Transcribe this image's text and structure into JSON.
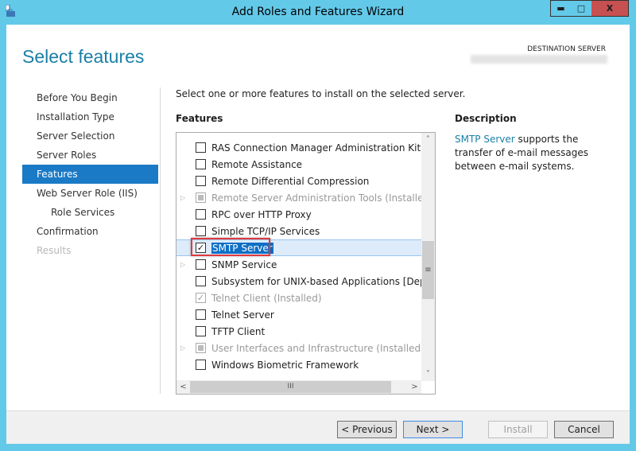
{
  "window": {
    "title": "Add Roles and Features Wizard",
    "minimize": "▬",
    "maximize": "□",
    "close": "X",
    "accent": "#63c9e9",
    "close_color": "#c75050"
  },
  "header": {
    "page_title": "Select features",
    "destination_label": "DESTINATION SERVER"
  },
  "nav": {
    "items": [
      {
        "label": "Before You Begin",
        "state": "normal"
      },
      {
        "label": "Installation Type",
        "state": "normal"
      },
      {
        "label": "Server Selection",
        "state": "normal"
      },
      {
        "label": "Server Roles",
        "state": "normal"
      },
      {
        "label": "Features",
        "state": "active"
      },
      {
        "label": "Web Server Role (IIS)",
        "state": "normal"
      },
      {
        "label": "Role Services",
        "state": "sub"
      },
      {
        "label": "Confirmation",
        "state": "normal"
      },
      {
        "label": "Results",
        "state": "disabled"
      }
    ]
  },
  "main": {
    "instruction": "Select one or more features to install on the selected server.",
    "features_heading": "Features",
    "features": [
      {
        "label": "RAS Connection Manager Administration Kit (CMA",
        "checked": false,
        "expandable": false,
        "installed": false
      },
      {
        "label": "Remote Assistance",
        "checked": false,
        "expandable": false,
        "installed": false
      },
      {
        "label": "Remote Differential Compression",
        "checked": false,
        "expandable": false,
        "installed": false
      },
      {
        "label": "Remote Server Administration Tools (Installed)",
        "checked": "partial",
        "expandable": true,
        "installed": true
      },
      {
        "label": "RPC over HTTP Proxy",
        "checked": false,
        "expandable": false,
        "installed": false
      },
      {
        "label": "Simple TCP/IP Services",
        "checked": false,
        "expandable": false,
        "installed": false
      },
      {
        "label": "SMTP Server",
        "checked": true,
        "expandable": false,
        "installed": false,
        "selected": true
      },
      {
        "label": "SNMP Service",
        "checked": false,
        "expandable": true,
        "installed": false
      },
      {
        "label": "Subsystem for UNIX-based Applications [Deprecat",
        "checked": false,
        "expandable": false,
        "installed": false
      },
      {
        "label": "Telnet Client (Installed)",
        "checked": true,
        "expandable": false,
        "installed": true
      },
      {
        "label": "Telnet Server",
        "checked": false,
        "expandable": false,
        "installed": false
      },
      {
        "label": "TFTP Client",
        "checked": false,
        "expandable": false,
        "installed": false
      },
      {
        "label": "User Interfaces and Infrastructure (Installed)",
        "checked": "partial",
        "expandable": true,
        "installed": true
      },
      {
        "label": "Windows Biometric Framework",
        "checked": false,
        "expandable": false,
        "installed": false
      }
    ]
  },
  "description": {
    "heading": "Description",
    "link": "SMTP Server",
    "text": " supports the transfer of e-mail messages between e-mail systems."
  },
  "footer": {
    "previous": "< Previous",
    "next": "Next >",
    "install": "Install",
    "cancel": "Cancel"
  }
}
